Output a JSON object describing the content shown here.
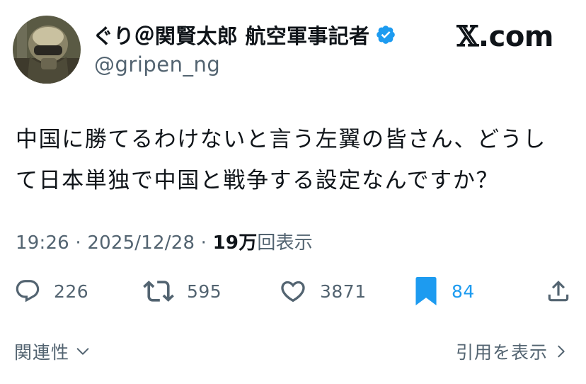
{
  "author": {
    "display_name": "ぐり＠関賢太郎 航空軍事記者",
    "handle": "@gripen_ng",
    "verified": true,
    "avatar_icon": "pilot-helmet-avatar"
  },
  "brand": {
    "label": ".com",
    "logo_icon": "x-logo"
  },
  "tweet": {
    "line1": "中国に勝てるわけないと言う左翼の皆さん、どうし",
    "line2": "て日本単独で中国と戦争する設定なんですか？"
  },
  "meta": {
    "time": "19:26",
    "sep1": " · ",
    "date": "2025/12/28",
    "sep2": " · ",
    "views_count": "19万",
    "views_label": "回表示"
  },
  "actions": {
    "reply": {
      "icon": "reply-icon",
      "count": "226"
    },
    "retweet": {
      "icon": "retweet-icon",
      "count": "595"
    },
    "like": {
      "icon": "heart-icon",
      "count": "3871"
    },
    "bookmark": {
      "icon": "bookmark-icon",
      "count": "84",
      "active": true
    },
    "share": {
      "icon": "share-icon"
    }
  },
  "footer": {
    "related": "関連性",
    "quote": "引用を表示"
  },
  "colors": {
    "text": "#0f1419",
    "secondary": "#536471",
    "accent": "#1d9bf0"
  }
}
